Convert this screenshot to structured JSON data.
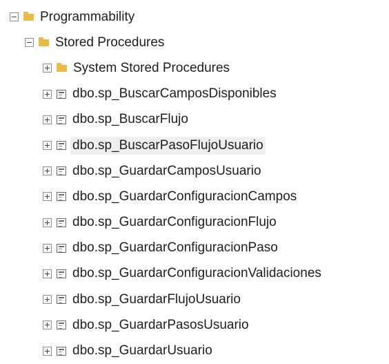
{
  "tree": {
    "root": {
      "label": "Programmability",
      "expanded": true,
      "icon": "folder-icon"
    },
    "folder": {
      "label": "Stored Procedures",
      "expanded": true,
      "icon": "folder-icon"
    },
    "items": [
      {
        "label": "System Stored Procedures",
        "icon": "folder-icon"
      },
      {
        "label": "dbo.sp_BuscarCamposDisponibles",
        "icon": "stored-procedure-icon"
      },
      {
        "label": "dbo.sp_BuscarFlujo",
        "icon": "stored-procedure-icon"
      },
      {
        "label": "dbo.sp_BuscarPasoFlujoUsuario",
        "icon": "stored-procedure-icon",
        "selected": true
      },
      {
        "label": "dbo.sp_GuardarCamposUsuario",
        "icon": "stored-procedure-icon"
      },
      {
        "label": "dbo.sp_GuardarConfiguracionCampos",
        "icon": "stored-procedure-icon"
      },
      {
        "label": "dbo.sp_GuardarConfiguracionFlujo",
        "icon": "stored-procedure-icon"
      },
      {
        "label": "dbo.sp_GuardarConfiguracionPaso",
        "icon": "stored-procedure-icon"
      },
      {
        "label": "dbo.sp_GuardarConfiguracionValidaciones",
        "icon": "stored-procedure-icon"
      },
      {
        "label": "dbo.sp_GuardarFlujoUsuario",
        "icon": "stored-procedure-icon"
      },
      {
        "label": "dbo.sp_GuardarPasosUsuario",
        "icon": "stored-procedure-icon"
      },
      {
        "label": "dbo.sp_GuardarUsuario",
        "icon": "stored-procedure-icon"
      }
    ]
  }
}
